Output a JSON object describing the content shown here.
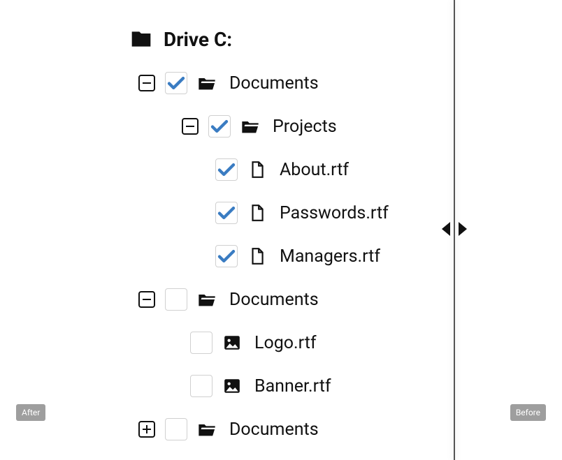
{
  "accent": "#3a7cc2",
  "root": {
    "label": "Drive C:"
  },
  "nodes": [
    {
      "toggle": "collapse",
      "checked": true,
      "icon": "folder-open",
      "label": "Documents",
      "indent": 1
    },
    {
      "toggle": "collapse",
      "checked": true,
      "icon": "folder-open",
      "label": "Projects",
      "indent": 2
    },
    {
      "toggle": null,
      "checked": true,
      "icon": "file",
      "label": "About.rtf",
      "indent": 3
    },
    {
      "toggle": null,
      "checked": true,
      "icon": "file",
      "label": "Passwords.rtf",
      "indent": 3
    },
    {
      "toggle": null,
      "checked": true,
      "icon": "file",
      "label": "Managers.rtf",
      "indent": 3
    },
    {
      "toggle": "collapse",
      "checked": false,
      "icon": "folder-open",
      "label": "Documents",
      "indent": 1
    },
    {
      "toggle": null,
      "checked": false,
      "icon": "image",
      "label": "Logo.rtf",
      "indent": 4
    },
    {
      "toggle": null,
      "checked": false,
      "icon": "image",
      "label": "Banner.rtf",
      "indent": 4
    },
    {
      "toggle": "expand",
      "checked": false,
      "icon": "folder-open",
      "label": "Documents",
      "indent": 1
    }
  ],
  "badges": {
    "after": "After",
    "before": "Before"
  }
}
